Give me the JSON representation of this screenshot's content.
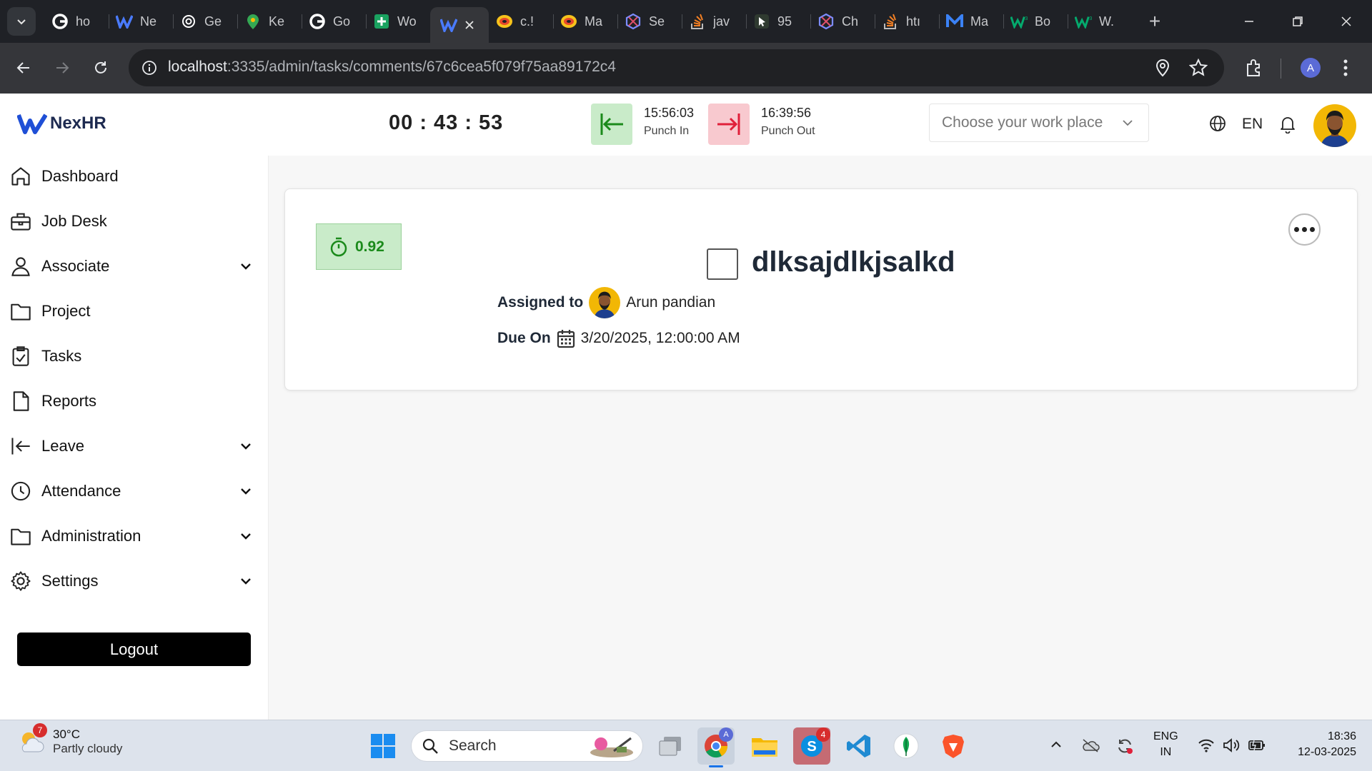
{
  "browser": {
    "tabs": [
      {
        "label": "ho",
        "icon": "google-icon"
      },
      {
        "label": "Ne",
        "icon": "nexhr-icon"
      },
      {
        "label": "Ge",
        "icon": "openai-icon"
      },
      {
        "label": "Ke",
        "icon": "maps-pin-icon"
      },
      {
        "label": "Go",
        "icon": "google-icon"
      },
      {
        "label": "Wo",
        "icon": "sheets-plus-icon"
      },
      {
        "label": "",
        "icon": "nexhr-icon",
        "active": true
      },
      {
        "label": "c.!",
        "icon": "colorful-icon"
      },
      {
        "label": "Ma",
        "icon": "colorful-icon"
      },
      {
        "label": "Se",
        "icon": "hexagon-icon"
      },
      {
        "label": "jav",
        "icon": "stackoverflow-icon"
      },
      {
        "label": "95",
        "icon": "cursor-icon"
      },
      {
        "label": "Ch",
        "icon": "hexagon-icon"
      },
      {
        "label": "htı",
        "icon": "stackoverflow-icon"
      },
      {
        "label": "Ma",
        "icon": "m-logo-icon"
      },
      {
        "label": "Bo",
        "icon": "w3-icon"
      },
      {
        "label": "W.",
        "icon": "w3-icon"
      }
    ],
    "url_host": "localhost",
    "url_rest": ":3335/admin/tasks/comments/67c6cea5f079f75aa89172c4",
    "profile_initial": "A"
  },
  "header": {
    "brand": "NexHR",
    "timer": "00 : 43 : 53",
    "punch_in_time": "15:56:03",
    "punch_in_label": "Punch In",
    "punch_out_time": "16:39:56",
    "punch_out_label": "Punch Out",
    "workplace_placeholder": "Choose your work place",
    "language": "EN"
  },
  "sidebar": {
    "items": [
      {
        "label": "Dashboard",
        "icon": "home-icon"
      },
      {
        "label": "Job Desk",
        "icon": "briefcase-icon"
      },
      {
        "label": "Associate",
        "icon": "user-icon",
        "expandable": true
      },
      {
        "label": "Project",
        "icon": "folder-icon"
      },
      {
        "label": "Tasks",
        "icon": "clipboard-check-icon"
      },
      {
        "label": "Reports",
        "icon": "file-icon"
      },
      {
        "label": "Leave",
        "icon": "arrow-left-bar-icon",
        "expandable": true
      },
      {
        "label": "Attendance",
        "icon": "clock-icon",
        "expandable": true
      },
      {
        "label": "Administration",
        "icon": "folder-icon",
        "expandable": true
      },
      {
        "label": "Settings",
        "icon": "gear-icon",
        "expandable": true
      }
    ],
    "logout_label": "Logout"
  },
  "task": {
    "score": "0.92",
    "title": "dlksajdlkjsalkd",
    "assigned_label": "Assigned to",
    "assignee": "Arun pandian",
    "due_label": "Due On",
    "due_date": "3/20/2025, 12:00:00 AM"
  },
  "taskbar": {
    "weather_temp": "30°C",
    "weather_desc": "Partly cloudy",
    "weather_badge": "7",
    "search_placeholder": "Search",
    "skype_badge": "4",
    "chrome_badge": "A",
    "lang_line1": "ENG",
    "lang_line2": "IN",
    "time": "18:36",
    "date": "12-03-2025"
  },
  "colors": {
    "punch_in_bg": "#c9ebc9",
    "punch_out_bg": "#f8c9cf",
    "score_text": "#1b8a1b",
    "brand_blue": "#1f4fd6"
  }
}
